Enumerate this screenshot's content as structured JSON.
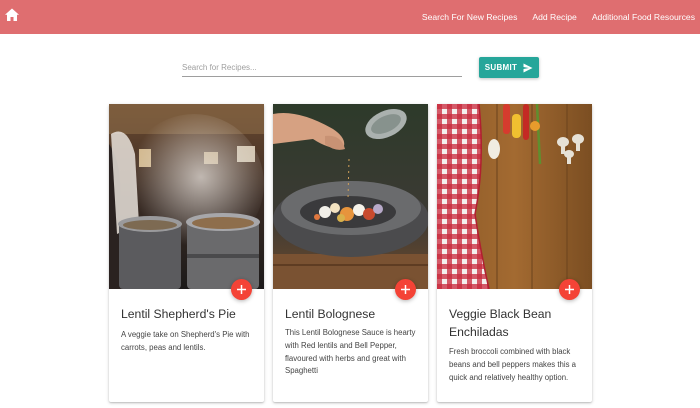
{
  "navbar": {
    "color": "#df6e70",
    "home_icon": "home-icon",
    "links": [
      "Search For New Recipes",
      "Add Recipe",
      "Additional Food Resources"
    ]
  },
  "search": {
    "placeholder": "Search for Recipes...",
    "value": "",
    "submit_label": "SUBMIT",
    "submit_icon": "send-icon",
    "submit_color": "#26a69a"
  },
  "cards": [
    {
      "title": "Lentil Shepherd's Pie",
      "description": "A veggie take on Shepherd's Pie with carrots, peas and lentils.",
      "image": "kitchen-steaming-pots-image",
      "add_icon": "plus-icon"
    },
    {
      "title": "Lentil Bolognese",
      "description": "This Lentil Bolognese Sauce is hearty with Red lentils and Bell Pepper, flavoured with herbs and great with Spaghetti",
      "image": "seasoning-stone-bowl-image",
      "add_icon": "plus-icon"
    },
    {
      "title": "Veggie Black Bean Enchiladas",
      "description": "Fresh broccoli combined with black beans and bell peppers makes this a quick and relatively healthy option.",
      "image": "vegetables-wooden-table-image",
      "add_icon": "plus-icon"
    }
  ],
  "fab_color": "#f44336"
}
